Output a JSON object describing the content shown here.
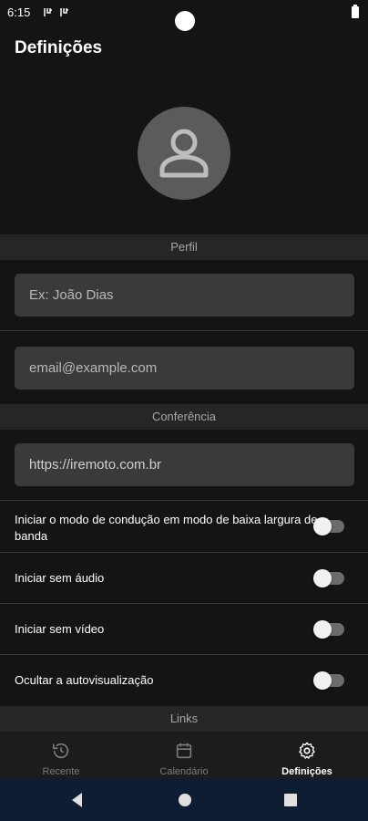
{
  "status_bar": {
    "time": "6:15"
  },
  "app": {
    "title": "Definições"
  },
  "sections": {
    "profile": "Perfil",
    "conference": "Conferência",
    "links": "Links"
  },
  "fields": {
    "name_placeholder": "Ex: João Dias",
    "email_placeholder": "email@example.com",
    "server_value": "https://iremoto.com.br"
  },
  "toggles": [
    {
      "label": "Iniciar o modo de condução em modo de baixa largura de banda",
      "on": false
    },
    {
      "label": "Iniciar sem áudio",
      "on": false
    },
    {
      "label": "Iniciar sem vídeo",
      "on": false
    },
    {
      "label": "Ocultar a autovisualização",
      "on": false
    }
  ],
  "bottom_nav": {
    "items": [
      {
        "label": "Recente",
        "icon": "history-icon",
        "active": false
      },
      {
        "label": "Calendário",
        "icon": "calendar-icon",
        "active": false
      },
      {
        "label": "Definições",
        "icon": "gear-icon",
        "active": true
      }
    ]
  },
  "colors": {
    "background": "#141414",
    "section_header": "#262626",
    "field": "#3a3a3a",
    "system_nav": "#0f1d33"
  }
}
